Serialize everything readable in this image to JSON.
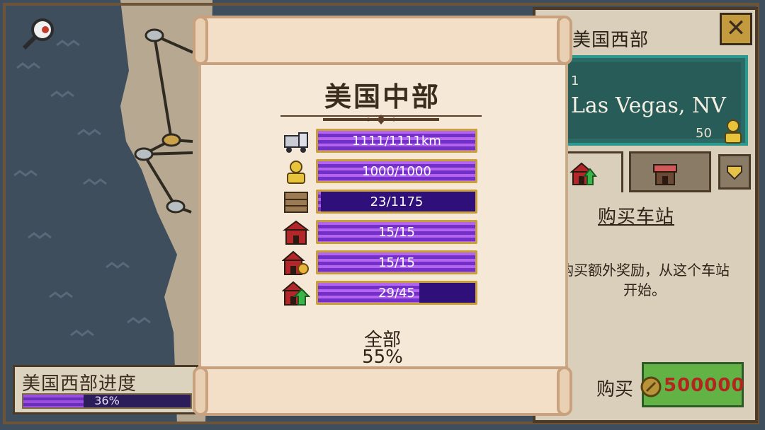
{
  "map": {
    "region_progress_label": "美国西部进度",
    "region_progress_value": "36%",
    "region_progress_fraction": 0.36
  },
  "side_panel": {
    "title": "美国西部",
    "close_icon": "close-x-icon",
    "station": {
      "index": "1",
      "name": "Las Vegas, NV",
      "count": "50"
    },
    "tabs": [
      {
        "name": "buy-station",
        "icon": "station-upgrade-icon",
        "active": true
      },
      {
        "name": "shop",
        "icon": "shop-icon",
        "active": false
      },
      {
        "name": "dropdown",
        "icon": "chevron-down-icon",
        "active": false
      }
    ],
    "heading": "购买车站",
    "description": "购买额外奖励，从这个车站开始。",
    "buy_label": "购买",
    "price": "500000",
    "colors": {
      "panel": "#d9cfba",
      "card": "#2c6a66",
      "buy_button": "#63b246",
      "price": "#b2261e"
    }
  },
  "dialog": {
    "title": "美国中部",
    "stats": [
      {
        "icon": "train-icon",
        "text": "1111/1111km",
        "fraction": 1.0
      },
      {
        "icon": "passenger-icon",
        "text": "1000/1000",
        "fraction": 1.0
      },
      {
        "icon": "crate-icon",
        "text": "23/1175",
        "fraction": 0.0196
      },
      {
        "icon": "station-icon",
        "text": "15/15",
        "fraction": 1.0
      },
      {
        "icon": "station-coin-icon",
        "text": "15/15",
        "fraction": 1.0
      },
      {
        "icon": "station-upgrade-icon",
        "text": "29/45",
        "fraction": 0.644
      }
    ],
    "total_label": "全部",
    "total_value": "55%",
    "colors": {
      "bar_bg": "#2f0f7a",
      "bar_fill": "#9a4de0",
      "bar_border": "#c7a137"
    }
  }
}
